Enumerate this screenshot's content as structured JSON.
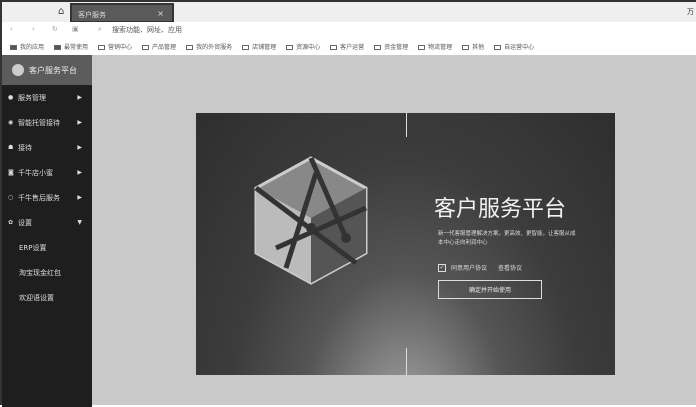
{
  "browser": {
    "tab_title": "客户服务",
    "corner_text": "万",
    "address_placeholder": "搜索功能、网址、应用"
  },
  "bookmarks": [
    "我的应用",
    "最常使用",
    "营销中心",
    "产品管理",
    "我的外贸服务",
    "店铺管理",
    "资源中心",
    "客户运营",
    "资金管理",
    "物流管理",
    "其他",
    "自运营中心"
  ],
  "sidebar": {
    "brand": "客户服务平台",
    "items": [
      {
        "label": "服务管理",
        "icon": "bell-icon"
      },
      {
        "label": "智能托管接待",
        "icon": "location-icon"
      },
      {
        "label": "接待",
        "icon": "people-icon"
      },
      {
        "label": "千牛店小蜜",
        "icon": "robot-icon"
      },
      {
        "label": "千牛售后服务",
        "icon": "circle-icon"
      },
      {
        "label": "设置",
        "icon": "gear-icon"
      }
    ],
    "subitems": [
      "ERP设置",
      "淘宝现金红包",
      "欢迎语设置"
    ]
  },
  "card": {
    "title": "客户服务平台",
    "description": "新一代客服管理解决方案，更高效、更智能，让客服从成本中心走向利润中心",
    "agree_label": "同意用户协议",
    "view_agreement": "查看协议",
    "confirm_button": "确定并开始使用"
  }
}
